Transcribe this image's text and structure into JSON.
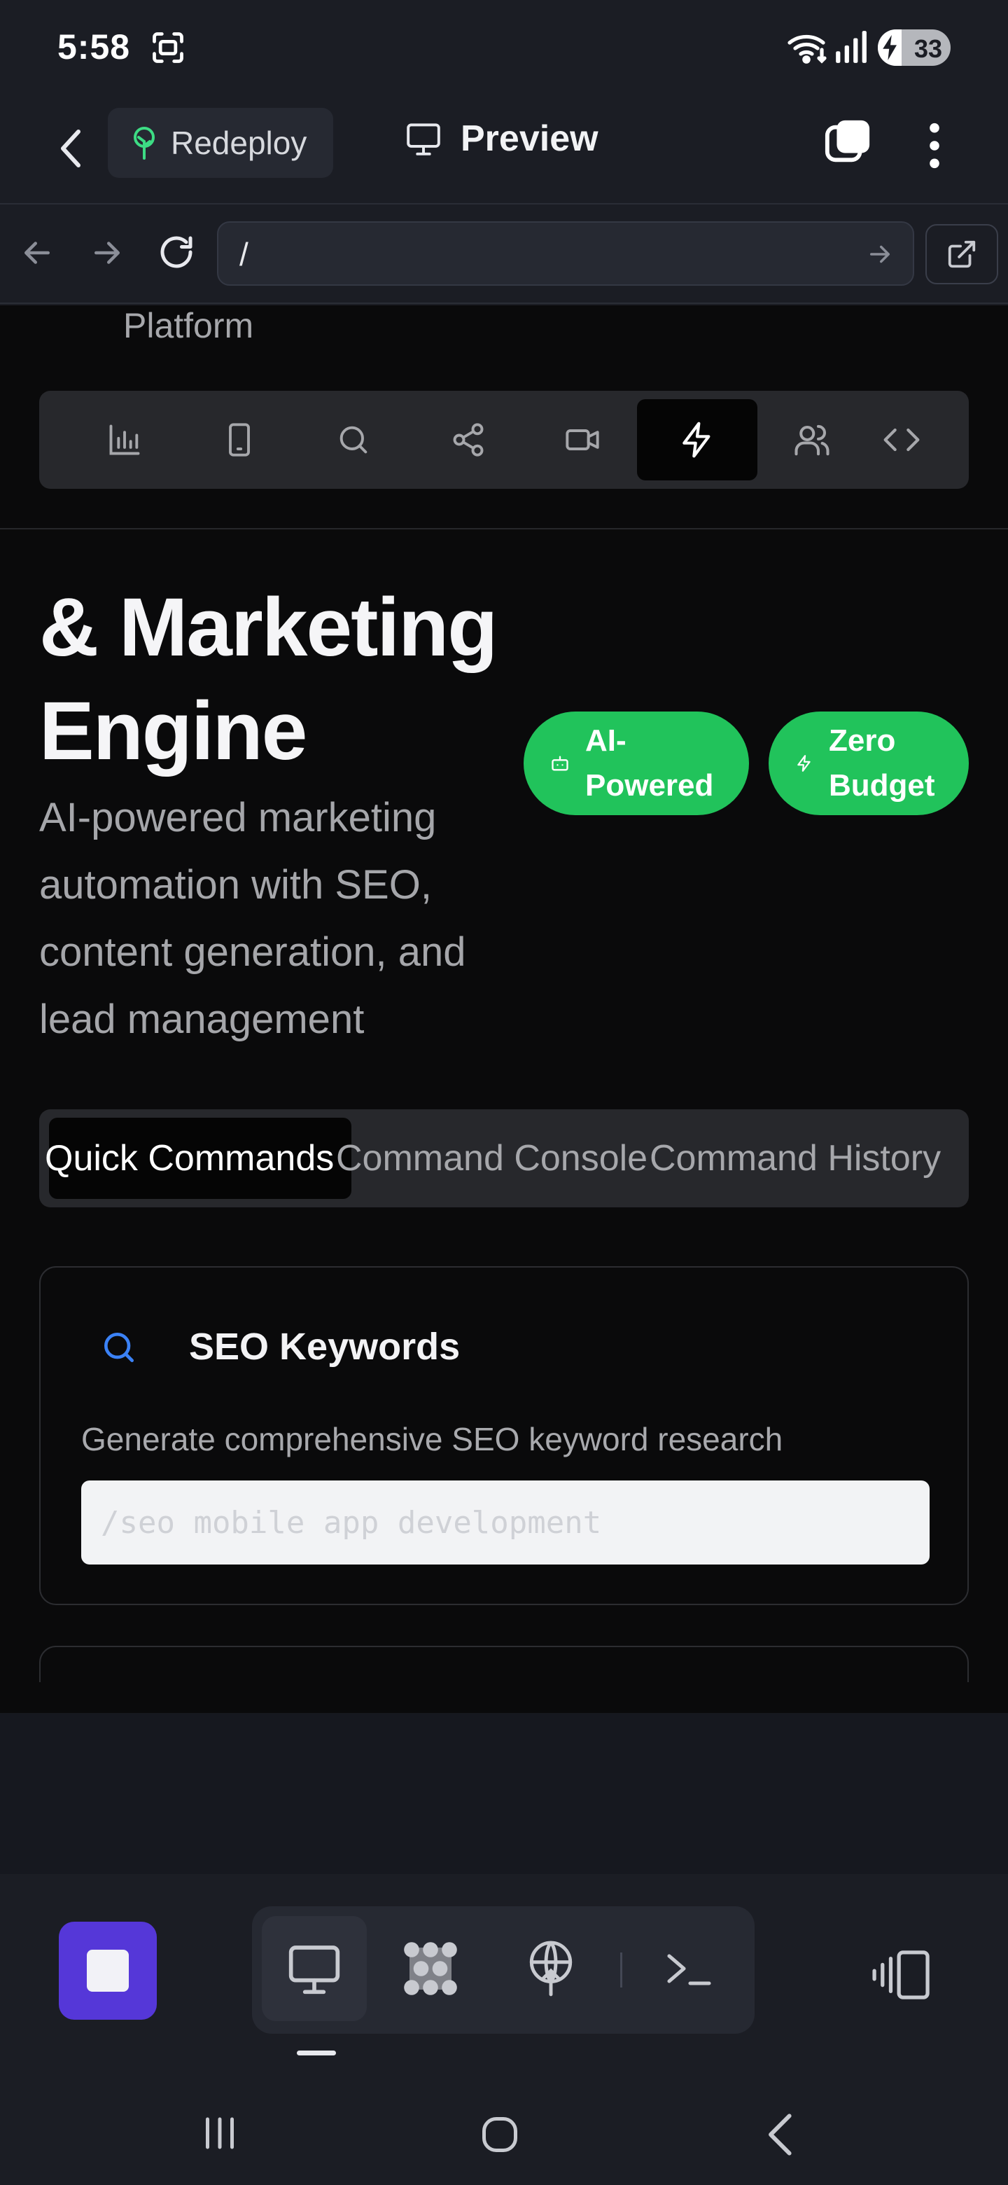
{
  "status_bar": {
    "time": "5:58",
    "battery_level": 33,
    "battery_label": "33",
    "icons": [
      "screenshot-icon",
      "wifi-icon",
      "signal-icon",
      "charging-bolt-icon"
    ]
  },
  "app_header": {
    "back_icon": "chevron-left-icon",
    "redeploy_label": "Redeploy",
    "redeploy_icon": "tree-icon",
    "preview_label": "Preview",
    "preview_icon": "monitor-icon",
    "tabs_icon": "tabs-icon",
    "menu_icon": "kebab-menu-icon"
  },
  "url_bar": {
    "url": "/",
    "back_icon": "arrow-left-icon",
    "forward_icon": "arrow-right-icon",
    "reload_icon": "reload-icon",
    "go_icon": "arrow-right-icon",
    "open_external_icon": "external-link-icon"
  },
  "web_page": {
    "platform_label": "Platform",
    "toolbar_icons": [
      "bar-chart-icon",
      "smartphone-icon",
      "search-icon",
      "share-icon",
      "video-icon",
      "zap-icon",
      "users-icon",
      "code-icon"
    ],
    "toolbar_active_index": 5,
    "hero_title": "& Marketing Engine",
    "hero_description": "AI-powered marketing automation with SEO, content generation, and lead management",
    "badges": [
      {
        "label": "AI-Powered",
        "icon": "bot-icon"
      },
      {
        "label": "Zero Budget",
        "icon": "zap-icon"
      }
    ],
    "tabs": [
      {
        "label": "Quick Commands",
        "active": true
      },
      {
        "label": "Command Console",
        "active": false
      },
      {
        "label": "Command History",
        "active": false
      }
    ],
    "seo_card": {
      "title": "SEO Keywords",
      "icon": "search-icon",
      "description": "Generate comprehensive SEO keyword research",
      "placeholder": "/seo mobile app development"
    },
    "colors": {
      "accent_green": "#21c35b",
      "accent_blue": "#3b82f6",
      "stop_purple": "#5537d8"
    }
  },
  "bottom_toolbar": {
    "stop_icon": "stop-icon",
    "modes": [
      "monitor-icon",
      "grid-dots-icon",
      "deploy-icon",
      "terminal-icon"
    ],
    "active_mode_index": 0,
    "panel_icon": "panel-toggle-icon"
  },
  "android_nav": [
    "recent-apps-icon",
    "home-icon",
    "back-icon"
  ]
}
